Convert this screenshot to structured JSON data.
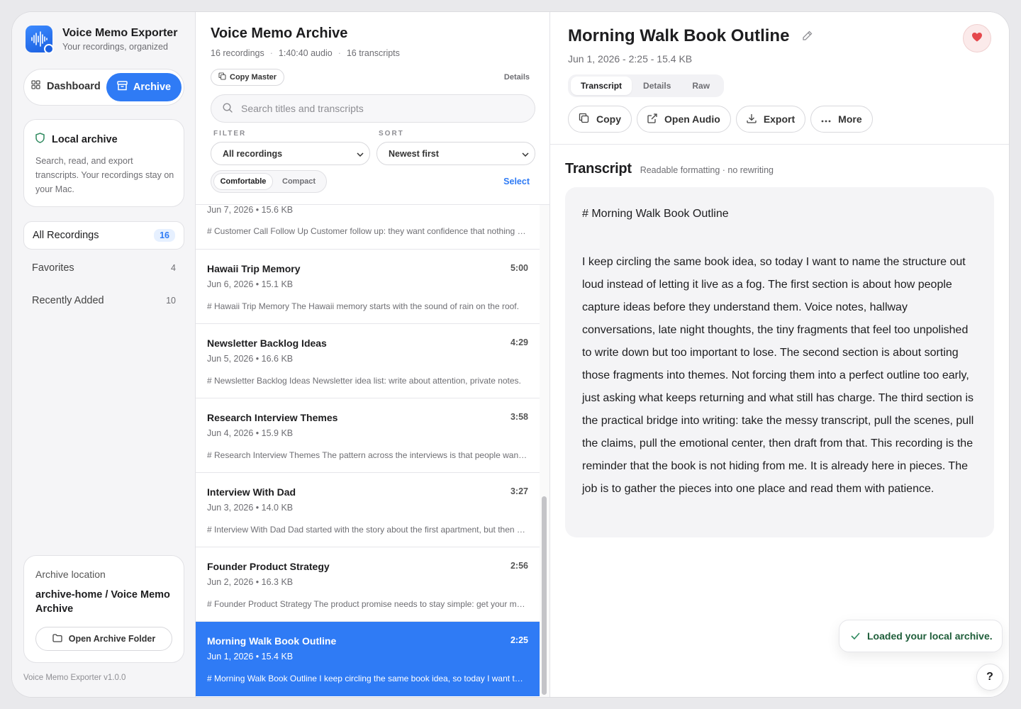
{
  "app": {
    "title": "Voice Memo Exporter",
    "subtitle": "Your recordings, organized",
    "version": "Voice Memo Exporter v1.0.0"
  },
  "modes": {
    "dashboard": "Dashboard",
    "archive": "Archive"
  },
  "local_card": {
    "title": "Local archive",
    "description": "Search, read, and export transcripts. Your recordings stay on your Mac."
  },
  "nav": [
    {
      "label": "All Recordings",
      "count": "16"
    },
    {
      "label": "Favorites",
      "count": "4"
    },
    {
      "label": "Recently Added",
      "count": "10"
    }
  ],
  "location": {
    "label": "Archive location",
    "path": "archive-home / Voice Memo Archive",
    "button": "Open Archive Folder"
  },
  "list": {
    "title": "Voice Memo Archive",
    "stats": [
      "16 recordings",
      "1:40:40 audio",
      "16 transcripts"
    ],
    "copy_master": "Copy Master",
    "details": "Details",
    "search_placeholder": "Search titles and transcripts",
    "filter_label": "FILTER",
    "sort_label": "SORT",
    "filter_value": "All recordings",
    "sort_value": "Newest first",
    "density_on": "Comfortable",
    "density_off": "Compact",
    "select": "Select",
    "partial_row": {
      "meta": "Jun 7, 2026 • 15.6 KB",
      "snippet": "# Customer Call Follow Up Customer follow up: they want confidence that nothing gets lost."
    },
    "rows": [
      {
        "title": "Hawaii Trip Memory",
        "duration": "5:00",
        "meta": "Jun 6, 2026 • 15.1 KB",
        "snippet": "# Hawaii Trip Memory The Hawaii memory starts with the sound of rain on the roof."
      },
      {
        "title": "Newsletter Backlog Ideas",
        "duration": "4:29",
        "meta": "Jun 5, 2026 • 16.6 KB",
        "snippet": "# Newsletter Backlog Ideas Newsletter idea list: write about attention, private notes."
      },
      {
        "title": "Research Interview Themes",
        "duration": "3:58",
        "meta": "Jun 4, 2026 • 15.9 KB",
        "snippet": "# Research Interview Themes The pattern across the interviews is that people want control."
      },
      {
        "title": "Interview With Dad",
        "duration": "3:27",
        "meta": "Jun 3, 2026 • 14.0 KB",
        "snippet": "# Interview With Dad Dad started with the story about the first apartment, but then drifted."
      },
      {
        "title": "Founder Product Strategy",
        "duration": "2:56",
        "meta": "Jun 2, 2026 • 16.3 KB",
        "snippet": "# Founder Product Strategy The product promise needs to stay simple: get your memos out."
      },
      {
        "title": "Morning Walk Book Outline",
        "duration": "2:25",
        "meta": "Jun 1, 2026 • 15.4 KB",
        "snippet": "# Morning Walk Book Outline I keep circling the same book idea, so today I want to name it."
      }
    ]
  },
  "detail": {
    "title": "Morning Walk Book Outline",
    "meta": "Jun 1, 2026 - 2:25 - 15.4 KB",
    "tabs": [
      "Transcript",
      "Details",
      "Raw"
    ],
    "actions": [
      "Copy",
      "Open Audio",
      "Export",
      "More"
    ],
    "transcript_title": "Transcript",
    "transcript_sub": "Readable formatting · no rewriting",
    "transcript_heading": "# Morning Walk Book Outline",
    "transcript_body": "I keep circling the same book idea, so today I want to name the structure out loud instead of letting it live as a fog. The first section is about how people capture ideas before they understand them. Voice notes, hallway conversations, late night thoughts, the tiny fragments that feel too unpolished to write down but too important to lose. The second section is about sorting those fragments into themes. Not forcing them into a perfect outline too early, just asking what keeps returning and what still has charge. The third section is the practical bridge into writing: take the messy transcript, pull the scenes, pull the claims, pull the emotional center, then draft from that. This recording is the reminder that the book is not hiding from me. It is already here in pieces. The job is to gather the pieces into one place and read them with patience."
  },
  "toast": "Loaded your local archive.",
  "help": "?",
  "colors": {
    "accent": "#2f7bf5",
    "favorite": "#e5484d",
    "toast_text": "#1f5e3a"
  }
}
